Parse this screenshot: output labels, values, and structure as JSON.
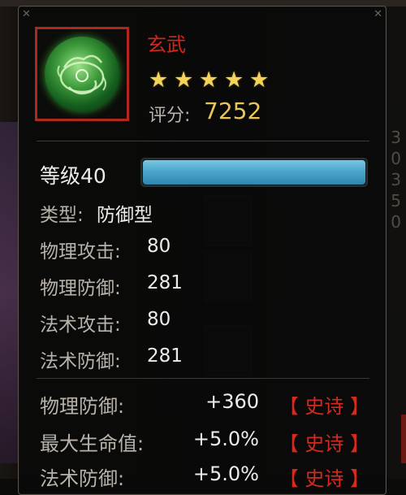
{
  "background": {
    "right_column": [
      "3",
      "0",
      "3",
      "5",
      "0"
    ]
  },
  "item": {
    "name": "玄武",
    "stars": 5,
    "star_glyph": "★",
    "icon": "xuanwu-orb-icon",
    "score_label": "评分:",
    "score_value": "7252"
  },
  "level": {
    "label": "等级40",
    "bar_fraction": 1.0
  },
  "base_stats": {
    "type_label": "类型:",
    "type_value": "防御型",
    "rows": [
      {
        "label": "物理攻击:",
        "value": "80"
      },
      {
        "label": "物理防御:",
        "value": "281"
      },
      {
        "label": "法术攻击:",
        "value": "80"
      },
      {
        "label": "法术防御:",
        "value": "281"
      }
    ]
  },
  "bonus_stats": [
    {
      "label": "物理防御:",
      "value": "+360",
      "quality": "【 史诗 】"
    },
    {
      "label": "最大生命值:",
      "value": "+5.0%",
      "quality": "【 史诗 】"
    },
    {
      "label": "法术防御:",
      "value": "+5.0%",
      "quality": "【 史诗 】"
    }
  ],
  "colors": {
    "name_red": "#d8241b",
    "score_gold": "#e9c65a",
    "epic_red": "#d52a1e",
    "level_bar": "#4ba6cc"
  }
}
